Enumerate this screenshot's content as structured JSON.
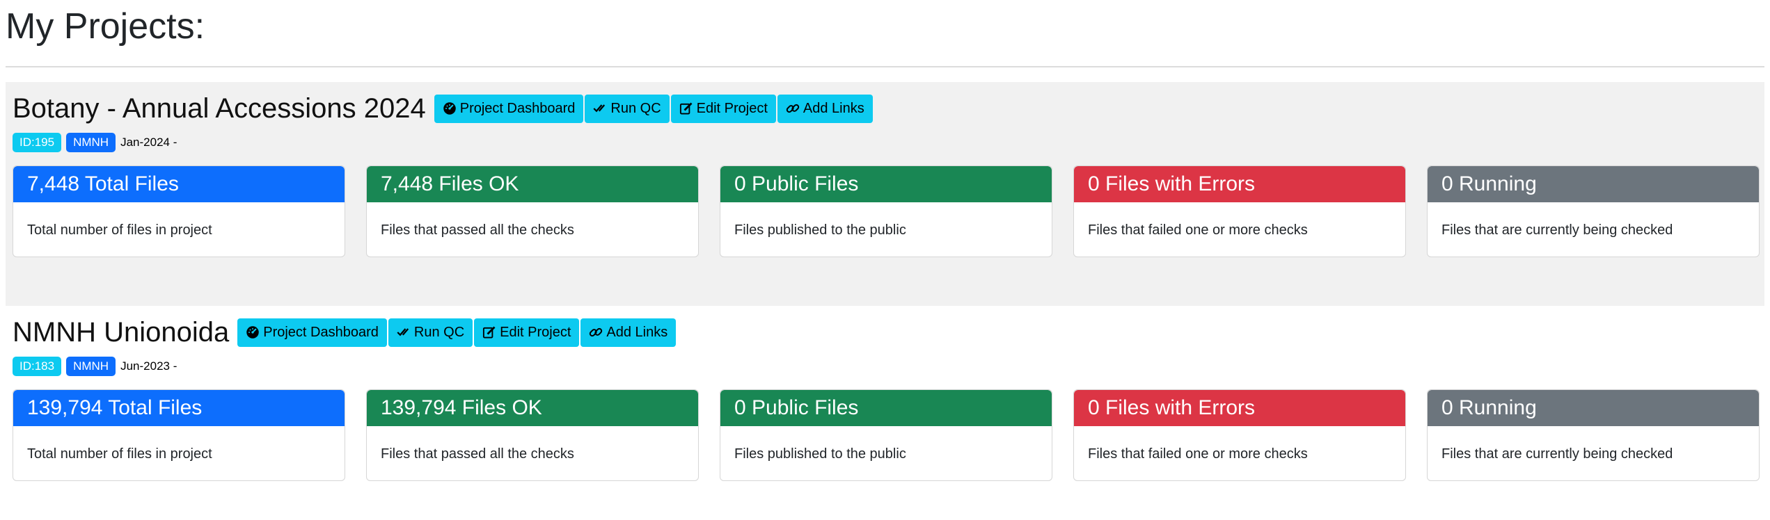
{
  "page": {
    "title": "My Projects:"
  },
  "buttons": {
    "dashboard": "Project Dashboard",
    "qc": "Run QC",
    "edit": "Edit Project",
    "links": "Add Links"
  },
  "card_descriptions": {
    "total": "Total number of files in project",
    "ok": "Files that passed all the checks",
    "public": "Files published to the public",
    "errors": "Files that failed one or more checks",
    "running": "Files that are currently being checked"
  },
  "colors": {
    "btn": "#0dcaf0",
    "total": "#0d6efd",
    "ok": "#198754",
    "public": "#198754",
    "errors": "#dc3545",
    "running": "#6c757d",
    "badge_id": "#0dcaf0",
    "badge_org": "#0d6efd"
  },
  "projects": [
    {
      "title": "Botany - Annual Accessions 2024",
      "id_badge": "ID:195",
      "org_badge": "NMNH",
      "date": "Jan-2024 -",
      "stats": {
        "total": "7,448 Total Files",
        "ok": "7,448 Files OK",
        "public": "0 Public Files",
        "errors": "0 Files with Errors",
        "running": "0 Running"
      }
    },
    {
      "title": "NMNH Unionoida",
      "id_badge": "ID:183",
      "org_badge": "NMNH",
      "date": "Jun-2023 -",
      "stats": {
        "total": "139,794 Total Files",
        "ok": "139,794 Files OK",
        "public": "0 Public Files",
        "errors": "0 Files with Errors",
        "running": "0 Running"
      }
    }
  ]
}
